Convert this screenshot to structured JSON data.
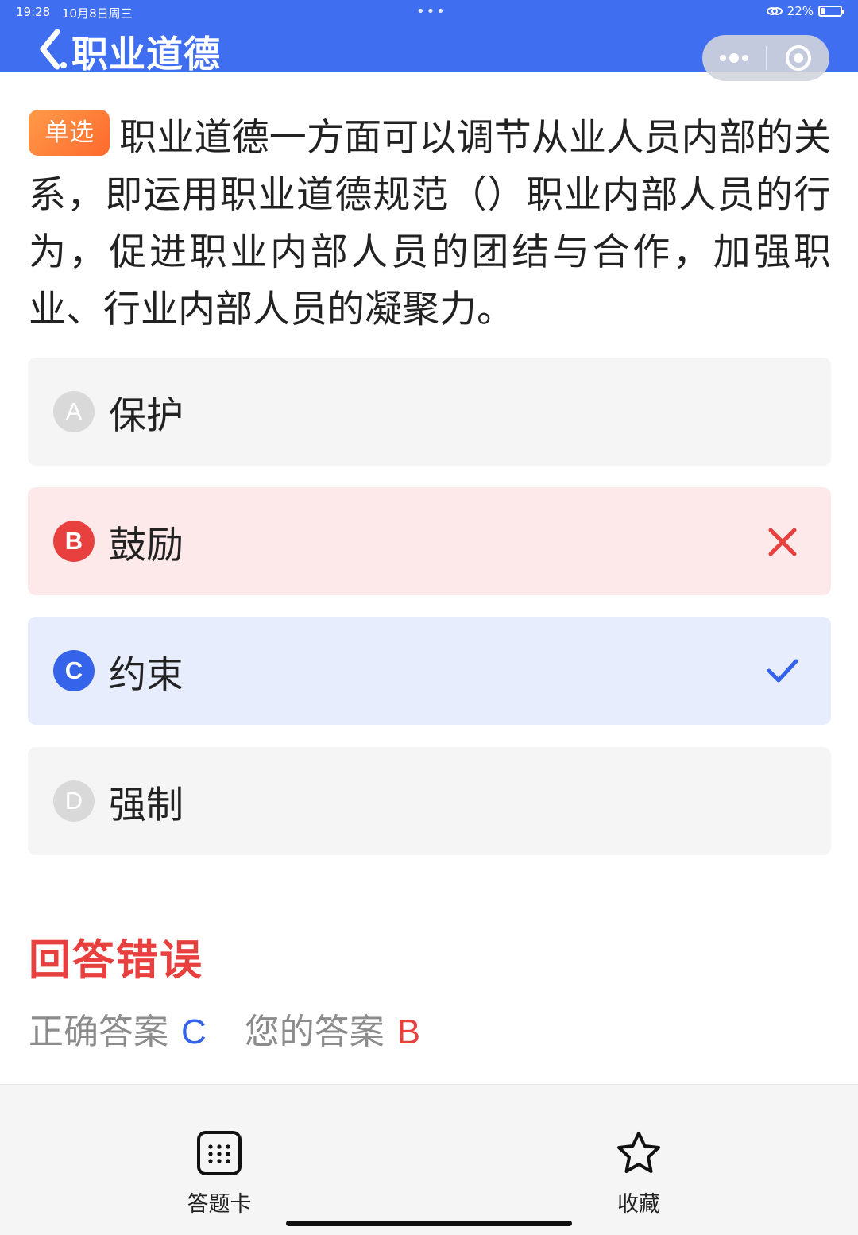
{
  "status_bar": {
    "time": "19:28",
    "date": "10月8日周三",
    "battery_text": "22%",
    "battery_level": 0.22
  },
  "header": {
    "title": "职业道德",
    "back_icon": "back-chevron-icon",
    "menu_icon": "more-dots-icon",
    "close_icon": "target-circle-icon",
    "color": "#3f6ef0"
  },
  "question": {
    "type_tag": "单选",
    "text": "职业道德一方面可以调节从业人员内部的关系，即运用职业道德规范（）职业内部人员的行为，促进职业内部人员的团结与合作，加强职业、行业内部人员的凝聚力。"
  },
  "options": [
    {
      "letter": "A",
      "text": "保护",
      "state": "normal"
    },
    {
      "letter": "B",
      "text": "鼓励",
      "state": "wrong"
    },
    {
      "letter": "C",
      "text": "约束",
      "state": "correct"
    },
    {
      "letter": "D",
      "text": "强制",
      "state": "normal"
    }
  ],
  "result": {
    "title": "回答错误",
    "correct_label": "正确答案",
    "correct_value": "C",
    "yours_label": "您的答案",
    "yours_value": "B"
  },
  "bottom_bar": {
    "answer_card_label": "答题卡",
    "favorite_label": "收藏"
  },
  "colors": {
    "accent": "#3563e9",
    "error": "#e8403f",
    "tag_orange": "#ff7a35"
  }
}
